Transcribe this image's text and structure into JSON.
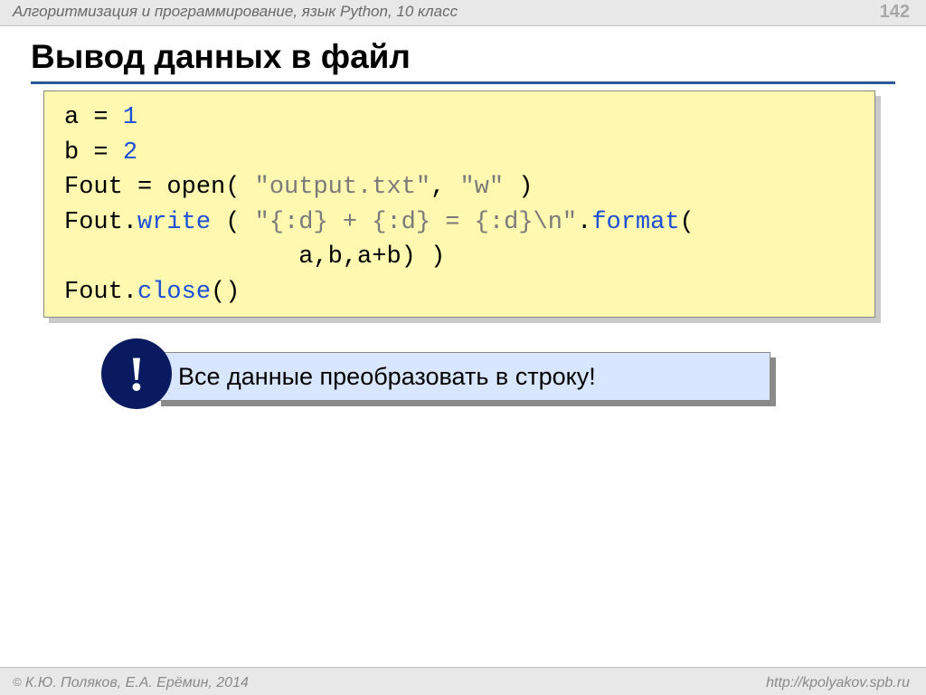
{
  "header": {
    "subject": "Алгоритмизация и программирование, язык Python, 10 класс",
    "page": "142"
  },
  "title": "Вывод данных в файл",
  "code": {
    "l1a": "a = ",
    "l1b": "1",
    "l2a": "b = ",
    "l2b": "2",
    "l3a": "Fout = open( ",
    "l3b": "\"output.txt\"",
    "l3c": ", ",
    "l3d": "\"w\"",
    "l3e": " )",
    "l4a": "Fout.",
    "l4b": "write",
    "l4c": " ( ",
    "l4d": "\"{:d} + {:d} = {:d}\\n\"",
    "l4e": ".",
    "l4f": "format",
    "l4g": "(",
    "l5": "                a,b,a+b) )",
    "l6a": "Fout.",
    "l6b": "close",
    "l6c": "()"
  },
  "note": {
    "bang": "!",
    "text": "Все данные преобразовать в строку!"
  },
  "footer": {
    "copy_symbol": "©",
    "authors": " К.Ю. Поляков, Е.А. Ерёмин, 2014",
    "url": "http://kpolyakov.spb.ru"
  }
}
